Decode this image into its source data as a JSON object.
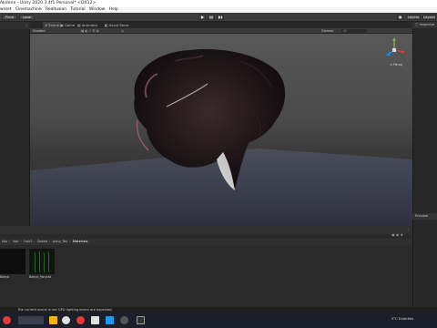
{
  "window": {
    "title": "Akdene - Unity 2020.3.4f1 Personal* <DX12>"
  },
  "menubar": {
    "items": [
      "wsset",
      "Cinemachine",
      "Realtusion",
      "Tutorial",
      "Window",
      "Help"
    ]
  },
  "toolbar": {
    "pivot_label": "Pivot",
    "local_label": "Local",
    "play_icon": "play-icon",
    "pause_icon": "pause-icon",
    "step_icon": "step-icon",
    "layers_label": "Layers",
    "layout_label": "Layout"
  },
  "left_panel": {
    "tab_label": ""
  },
  "scene_tabs": {
    "scene": "Scene",
    "game": "Game",
    "animator": "Animator",
    "asset_store": "Asset Store"
  },
  "scene_toolbar": {
    "shading_mode": "Shaded",
    "gizmos_label": "Gizmos",
    "search_placeholder": "All"
  },
  "viewport": {
    "persp_label": "< Persp"
  },
  "right_panel": {
    "inspector_tab": "Inspector",
    "preview_tab": "Preview"
  },
  "project": {
    "breadcrumb": [
      "Ass",
      "hair",
      "hair2",
      "Baked",
      "pony_fbx",
      "Materials"
    ]
  },
  "assets": [
    {
      "name": "Babyb",
      "color": "#0d0d0d"
    },
    {
      "name": "Babyd_Ponytail",
      "color": "#112211"
    }
  ],
  "statusbar": {
    "message": "the current scene is not GPU lighting errors are expected."
  },
  "taskbar": {
    "weather": "5°C  Eclairées"
  }
}
